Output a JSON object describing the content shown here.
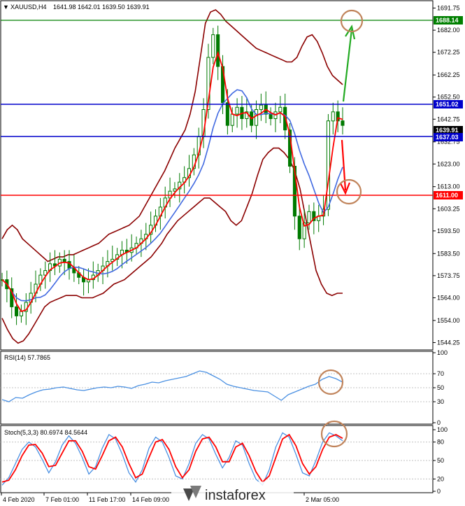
{
  "header": {
    "symbol": "XAUUSD,H4",
    "ohlc": "1641.98 1642.01 1639.50 1639.91"
  },
  "rsi_header": "RSI(14) 57.7865",
  "stoch_header": "Stoch(5,3,3) 80.6974 84.5644",
  "watermark": "instaforex",
  "colors": {
    "candle": "#007a00",
    "bollinger": "#8b0000",
    "ma_fast": "#ff0000",
    "ma_slow": "#4169e1",
    "resistance": "#0000cc",
    "support": "#ff0000",
    "target_line": "#008000",
    "rsi_line": "#4a90e2",
    "stoch_main": "#4a90e2",
    "stoch_signal": "#ff0000",
    "circle": "#c0835a"
  },
  "levels": {
    "target": "1688.14",
    "resistance": "1651.02",
    "current": "1639.91",
    "support_upper": "1637.03",
    "support_lower": "1611.00"
  },
  "chart_data": [
    {
      "type": "candlestick",
      "ylim": [
        1541,
        1695
      ],
      "y_ticks": [
        "1691.75",
        "1682.00",
        "1672.25",
        "1662.25",
        "1652.50",
        "1642.75",
        "1632.75",
        "1623.00",
        "1613.00",
        "1603.25",
        "1593.50",
        "1583.50",
        "1573.75",
        "1564.00",
        "1554.00",
        "1544.25"
      ],
      "x_ticks": [
        "4 Feb 2020",
        "7 Feb 01:00",
        "11 Feb 17:00",
        "14 Feb 09:00",
        "2 Mar 05:00"
      ],
      "close": [
        1572,
        1568,
        1560,
        1556,
        1558,
        1562,
        1566,
        1570,
        1574,
        1576,
        1579,
        1578,
        1581,
        1580,
        1577,
        1575,
        1573,
        1571,
        1572,
        1574,
        1576,
        1578,
        1580,
        1581,
        1583,
        1585,
        1584,
        1586,
        1588,
        1590,
        1592,
        1596,
        1600,
        1604,
        1608,
        1611,
        1612,
        1615,
        1617,
        1621,
        1627,
        1635,
        1647,
        1670,
        1680,
        1666,
        1650,
        1640,
        1645,
        1648,
        1643,
        1646,
        1640,
        1647,
        1649,
        1645,
        1643,
        1646,
        1648,
        1638,
        1622,
        1600,
        1590,
        1597,
        1602,
        1598,
        1600,
        1603,
        1642,
        1646,
        1642,
        1640
      ],
      "bollinger_upper": [
        1590,
        1594,
        1596,
        1594,
        1590,
        1588,
        1586,
        1584,
        1582,
        1580,
        1581,
        1582,
        1582,
        1583,
        1583,
        1584,
        1585,
        1586,
        1587,
        1588,
        1590,
        1592,
        1593,
        1594,
        1595,
        1596,
        1598,
        1600,
        1604,
        1608,
        1612,
        1616,
        1620,
        1625,
        1630,
        1634,
        1638,
        1645,
        1655,
        1670,
        1685,
        1690,
        1691,
        1689,
        1686,
        1684,
        1682,
        1680,
        1678,
        1676,
        1674,
        1673,
        1672,
        1671,
        1670,
        1669,
        1668,
        1668,
        1670,
        1675,
        1679,
        1680,
        1677,
        1672,
        1666,
        1662,
        1660,
        1658
      ],
      "bollinger_lower": [
        1555,
        1550,
        1546,
        1544,
        1545,
        1548,
        1552,
        1556,
        1560,
        1562,
        1563,
        1564,
        1565,
        1565,
        1565,
        1564,
        1564,
        1564,
        1565,
        1566,
        1568,
        1570,
        1571,
        1572,
        1574,
        1576,
        1578,
        1580,
        1582,
        1585,
        1588,
        1592,
        1595,
        1598,
        1600,
        1602,
        1604,
        1606,
        1608,
        1608,
        1606,
        1604,
        1602,
        1598,
        1596,
        1598,
        1604,
        1610,
        1618,
        1625,
        1628,
        1630,
        1630,
        1628,
        1625,
        1620,
        1612,
        1600,
        1588,
        1576,
        1570,
        1566,
        1565,
        1566,
        1566
      ]
    },
    {
      "type": "line",
      "name": "RSI(14)",
      "ylim": [
        0,
        100
      ],
      "y_ticks": [
        "100",
        "70",
        "50",
        "30",
        "0"
      ],
      "levels": [
        70,
        50,
        30
      ],
      "values": [
        33,
        30,
        36,
        35,
        40,
        44,
        47,
        48,
        50,
        51,
        49,
        47,
        46,
        48,
        50,
        51,
        50,
        52,
        51,
        49,
        53,
        55,
        58,
        57,
        60,
        62,
        64,
        66,
        70,
        74,
        72,
        67,
        62,
        55,
        52,
        50,
        48,
        46,
        45,
        44,
        38,
        32,
        40,
        44,
        48,
        52,
        55,
        62,
        66,
        63,
        58
      ]
    },
    {
      "type": "line",
      "name": "Stoch(5,3,3)",
      "ylim": [
        0,
        100
      ],
      "y_ticks": [
        "100",
        "80",
        "50",
        "20",
        "0"
      ],
      "levels": [
        80,
        50,
        20
      ],
      "main": [
        10,
        22,
        45,
        68,
        80,
        72,
        52,
        30,
        48,
        75,
        90,
        78,
        55,
        28,
        40,
        70,
        92,
        85,
        60,
        30,
        15,
        35,
        70,
        88,
        80,
        55,
        25,
        20,
        45,
        78,
        92,
        85,
        60,
        38,
        55,
        82,
        75,
        45,
        20,
        10,
        35,
        72,
        95,
        88,
        60,
        30,
        25,
        50,
        80,
        95,
        90,
        82
      ],
      "signal": [
        15,
        18,
        35,
        58,
        75,
        76,
        62,
        40,
        42,
        62,
        82,
        82,
        65,
        40,
        36,
        58,
        82,
        88,
        72,
        45,
        22,
        28,
        55,
        80,
        84,
        68,
        40,
        22,
        35,
        65,
        85,
        88,
        72,
        48,
        48,
        72,
        78,
        58,
        32,
        15,
        25,
        55,
        85,
        92,
        74,
        45,
        28,
        40,
        68,
        88,
        92,
        86
      ]
    }
  ]
}
